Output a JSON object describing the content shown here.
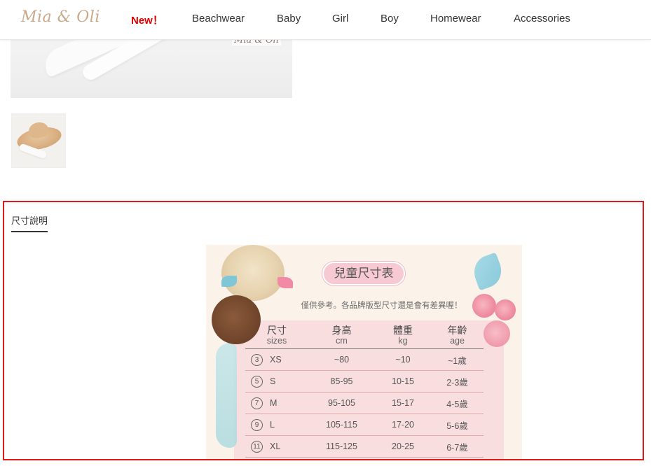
{
  "header": {
    "logo": "Mia & Oli",
    "nav": [
      {
        "label": "New！",
        "highlight": true
      },
      {
        "label": "Beachwear"
      },
      {
        "label": "Baby"
      },
      {
        "label": "Girl"
      },
      {
        "label": "Boy"
      },
      {
        "label": "Homewear"
      },
      {
        "label": "Accessories"
      }
    ]
  },
  "gallery": {
    "watermark": "Mia & Oli"
  },
  "size_section": {
    "tab_label": "尺寸說明",
    "chart": {
      "title": "兒童尺寸表",
      "subtitle": "僅供參考。各品牌版型尺寸還是會有差異喔！",
      "columns": [
        {
          "zh": "尺寸",
          "en": "sizes"
        },
        {
          "zh": "身高",
          "en": "cm"
        },
        {
          "zh": "體重",
          "en": "kg"
        },
        {
          "zh": "年齡",
          "en": "age"
        }
      ],
      "rows": [
        {
          "num": "3",
          "size": "XS",
          "height": "~80",
          "weight": "~10",
          "age": "~1歲"
        },
        {
          "num": "5",
          "size": "S",
          "height": "85-95",
          "weight": "10-15",
          "age": "2-3歲"
        },
        {
          "num": "7",
          "size": "M",
          "height": "95-105",
          "weight": "15-17",
          "age": "4-5歲"
        },
        {
          "num": "9",
          "size": "L",
          "height": "105-115",
          "weight": "17-20",
          "age": "5-6歲"
        },
        {
          "num": "11",
          "size": "XL",
          "height": "115-125",
          "weight": "20-25",
          "age": "6-7歲"
        }
      ]
    }
  },
  "colors": {
    "new_highlight": "#e00000",
    "section_border": "#e01a1a",
    "logo": "#c9a98a",
    "chart_wash": "#f9dcde"
  }
}
